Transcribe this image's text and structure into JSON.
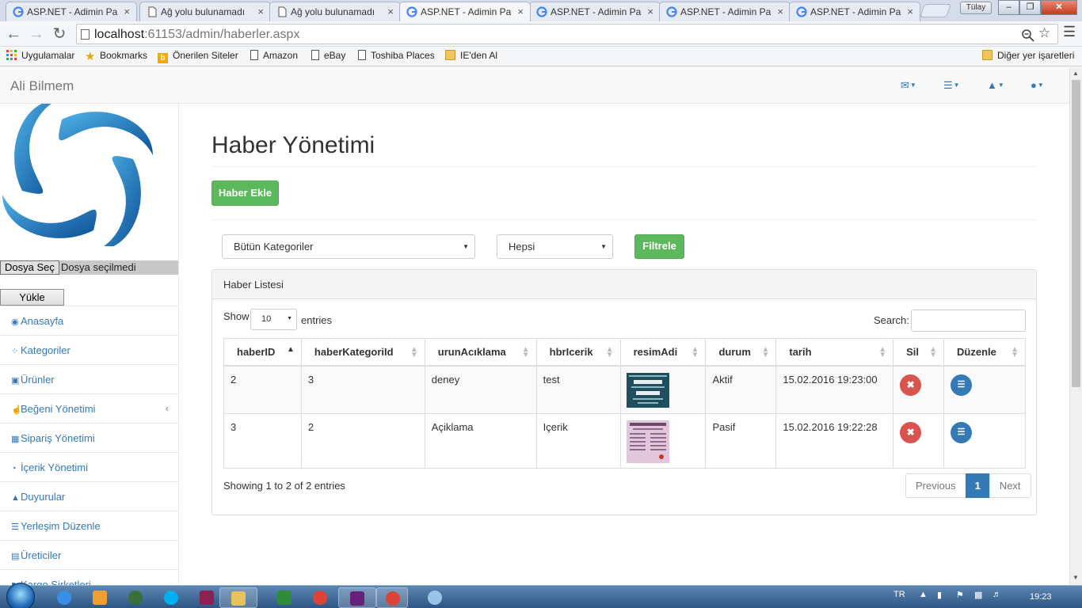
{
  "browser": {
    "tabs": [
      {
        "label": "ASP.NET - Adimin Pa",
        "icon": "google-icon",
        "active": false
      },
      {
        "label": "Ağ yolu bulunamadı",
        "icon": "page-icon",
        "active": false
      },
      {
        "label": "Ağ yolu bulunamadı",
        "icon": "page-icon",
        "active": false
      },
      {
        "label": "ASP.NET - Adimin Pa",
        "icon": "google-icon",
        "active": true
      },
      {
        "label": "ASP.NET - Adimin Pa",
        "icon": "google-icon",
        "active": false
      },
      {
        "label": "ASP.NET - Adimin Pa",
        "icon": "google-icon",
        "active": false
      },
      {
        "label": "ASP.NET - Adimin Pa",
        "icon": "google-icon",
        "active": false
      }
    ],
    "tab_close": "×",
    "user_badge": "Tülay",
    "window_buttons": {
      "minimize": "–",
      "maximize": "❐",
      "close": "✕"
    },
    "url_host": "localhost",
    "url_rest": ":61153/admin/haberler.aspx",
    "bookmarks": [
      {
        "label": "Uygulamalar",
        "icon": "apps-grid-icon"
      },
      {
        "label": "Bookmarks",
        "icon": "star-icon"
      },
      {
        "label": "Önerilen Siteler",
        "icon": "bing-icon"
      },
      {
        "label": "Amazon",
        "icon": "page-icon"
      },
      {
        "label": "eBay",
        "icon": "page-icon"
      },
      {
        "label": "Toshiba Places",
        "icon": "page-icon"
      },
      {
        "label": "IE'den Al",
        "icon": "folder-icon"
      }
    ],
    "other_bookmarks": "Diğer yer işaretleri"
  },
  "navbar": {
    "brand": "Ali Bilmem",
    "icons": [
      "envelope-icon",
      "tasks-icon",
      "bell-icon",
      "user-icon"
    ]
  },
  "sidebar": {
    "file_button": "Dosya Seç",
    "file_label": "Dosya seçilmedi",
    "upload_button": "Yükle",
    "items": [
      {
        "label": "Anasayfa",
        "icon": "dashboard-icon"
      },
      {
        "label": "Kategoriler",
        "icon": "spinner-icon"
      },
      {
        "label": "Ürünler",
        "icon": "cart-icon"
      },
      {
        "label": "Beğeni Yönetimi",
        "icon": "thumbs-up-icon",
        "chevron": "‹"
      },
      {
        "label": "Sipariş Yönetimi",
        "icon": "gift-icon"
      },
      {
        "label": "İçerik Yönetimi",
        "icon": "pie-chart-icon"
      },
      {
        "label": "Duyurular",
        "icon": "warning-icon"
      },
      {
        "label": "Yerleşim Düzenle",
        "icon": "list-icon"
      },
      {
        "label": "Üreticiler",
        "icon": "building-icon"
      },
      {
        "label": "Kargo Şirketleri",
        "icon": "truck-icon"
      }
    ]
  },
  "main": {
    "title": "Haber Yönetimi",
    "add_button": "Haber Ekle",
    "category_select": "Bütün Kategoriler",
    "status_select": "Hepsi",
    "filter_button": "Filtrele",
    "panel_title": "Haber Listesi",
    "show_label": "Show",
    "page_length": "10",
    "entries_label": "entries",
    "search_label": "Search:",
    "columns": [
      "haberID",
      "haberKategoriId",
      "urunAcıklama",
      "hbrIcerik",
      "resimAdi",
      "durum",
      "tarih",
      "Sil",
      "Düzenle"
    ],
    "rows": [
      {
        "haberID": "2",
        "kategori": "3",
        "aciklama": "deney",
        "icerik": "test",
        "resim": "before-after-thumbnail",
        "durum": "Aktif",
        "tarih": "15.02.2016 19:23:00"
      },
      {
        "haberID": "3",
        "kategori": "2",
        "aciklama": "Açiklama",
        "icerik": "Içerik",
        "resim": "commandments-thumbnail",
        "durum": "Pasif",
        "tarih": "15.02.2016 19:22:28"
      }
    ],
    "info": "Showing 1 to 2 of 2 entries",
    "pager": {
      "previous": "Previous",
      "current": "1",
      "next": "Next"
    }
  },
  "taskbar": {
    "lang": "TR",
    "time": "19:23"
  }
}
